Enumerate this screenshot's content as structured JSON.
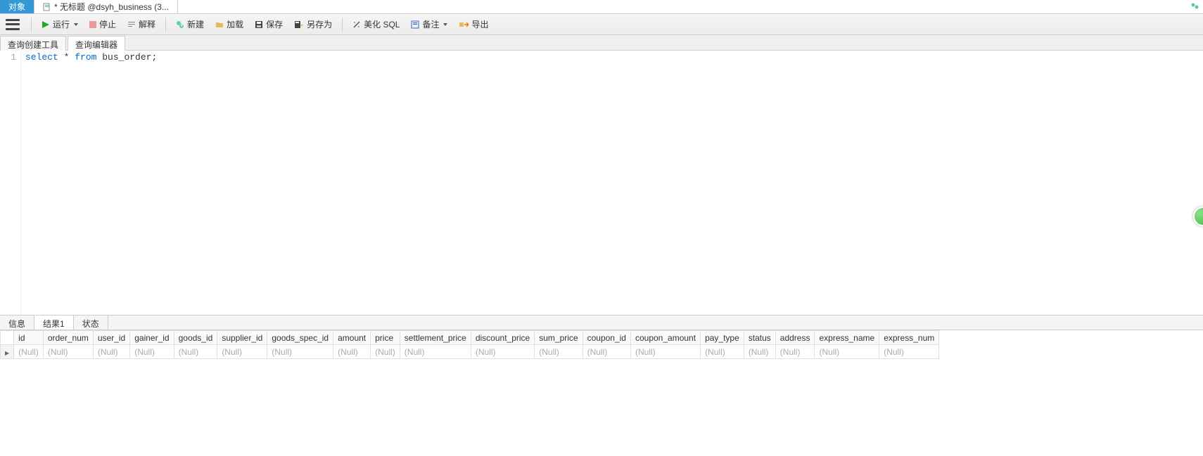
{
  "topTabs": [
    {
      "label": "对象",
      "active": true
    },
    {
      "label": "* 无标题 @dsyh_business (3...",
      "active": false
    }
  ],
  "toolbar": {
    "run": "运行",
    "stop": "停止",
    "explain": "解释",
    "new": "新建",
    "load": "加载",
    "save": "保存",
    "saveAs": "另存为",
    "beautify": "美化 SQL",
    "note": "备注",
    "export": "导出"
  },
  "subTabs": [
    {
      "label": "查询创建工具",
      "active": false
    },
    {
      "label": "查询编辑器",
      "active": true
    }
  ],
  "editor": {
    "lineNo": "1",
    "sqlKeywords1": "select",
    "sqlStar": " * ",
    "sqlKeywords2": "from",
    "sqlRest": " bus_order;"
  },
  "bottomTabs": [
    {
      "label": "信息",
      "active": false
    },
    {
      "label": "结果1",
      "active": true
    },
    {
      "label": "状态",
      "active": false
    }
  ],
  "resultColumns": [
    "id",
    "order_num",
    "user_id",
    "gainer_id",
    "goods_id",
    "supplier_id",
    "goods_spec_id",
    "amount",
    "price",
    "settlement_price",
    "discount_price",
    "sum_price",
    "coupon_id",
    "coupon_amount",
    "pay_type",
    "status",
    "address",
    "express_name",
    "express_num"
  ],
  "nullText": "(Null)"
}
